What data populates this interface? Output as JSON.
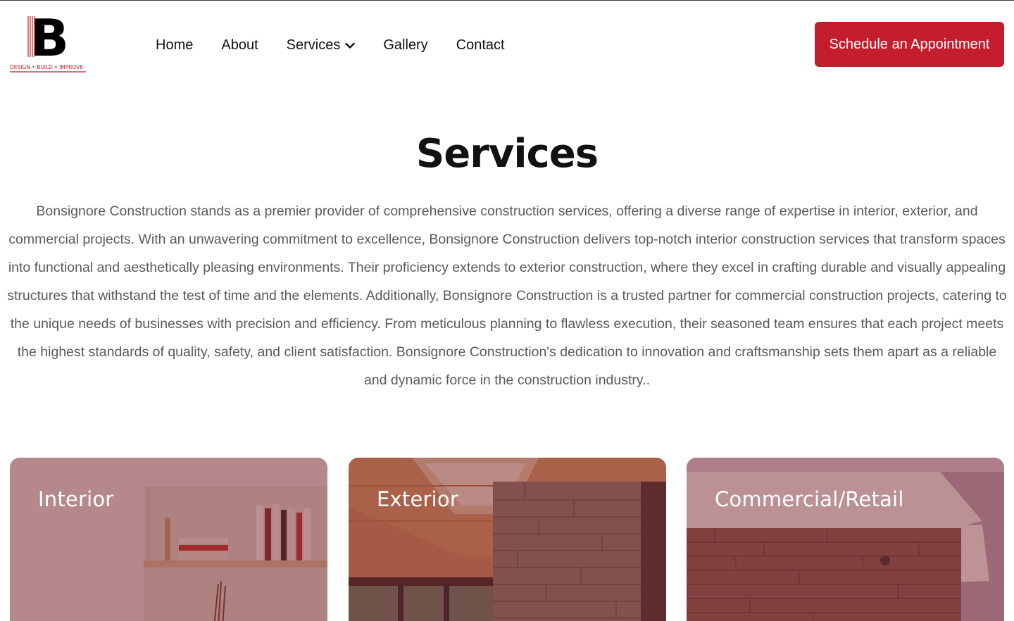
{
  "brand": {
    "letter": "B",
    "tagline": "DESIGN • BUILD • IMPROVE",
    "accent": "#c41e2e"
  },
  "nav": {
    "items": [
      {
        "label": "Home"
      },
      {
        "label": "About"
      },
      {
        "label": "Services",
        "has_dropdown": true
      },
      {
        "label": "Gallery"
      },
      {
        "label": "Contact"
      }
    ],
    "dropdown_icon": "chevron-down-icon"
  },
  "cta": {
    "label": "Schedule an Appointment"
  },
  "main": {
    "title": "Services",
    "intro": "Bonsignore Construction stands as a premier provider of comprehensive construction services, offering a diverse range of expertise in interior, exterior, and commercial projects. With an unwavering commitment to excellence, Bonsignore Construction delivers top-notch interior construction services that transform spaces into functional and aesthetically pleasing environments. Their proficiency extends to exterior construction, where they excel in crafting durable and visually appealing structures that withstand the test of time and the elements. Additionally, Bonsignore Construction is a trusted partner for commercial construction projects, catering to the unique needs of businesses with precision and efficiency. From meticulous planning to flawless execution, their seasoned team ensures that each project meets the highest standards of quality, safety, and client satisfaction. Bonsignore Construction's dedication to innovation and craftsmanship sets them apart as a reliable and dynamic force in the construction industry.."
  },
  "cards": [
    {
      "title": "Interior"
    },
    {
      "title": "Exterior"
    },
    {
      "title": "Commercial/Retail"
    }
  ]
}
